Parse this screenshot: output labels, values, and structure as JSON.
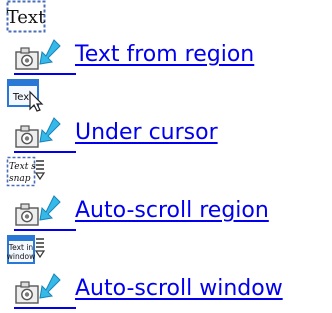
{
  "items": [
    {
      "label": "Text from region",
      "icon_text": "Text",
      "top_icon": "text-region-icon"
    },
    {
      "label": "Under cursor",
      "icon_text": "Tex",
      "top_icon": "under-cursor-icon"
    },
    {
      "label": "Auto-scroll region",
      "icon_text_line1": "Text s",
      "icon_text_line2": "snap",
      "top_icon": "auto-scroll-region-icon"
    },
    {
      "label": "Auto-scroll window",
      "icon_text_line1": "Text in",
      "icon_text_line2": "window",
      "top_icon": "auto-scroll-window-icon"
    }
  ],
  "colors": {
    "link": "#0000ee",
    "icon_blue": "#2a78d6",
    "arrow_cyan": "#35b9e8"
  }
}
